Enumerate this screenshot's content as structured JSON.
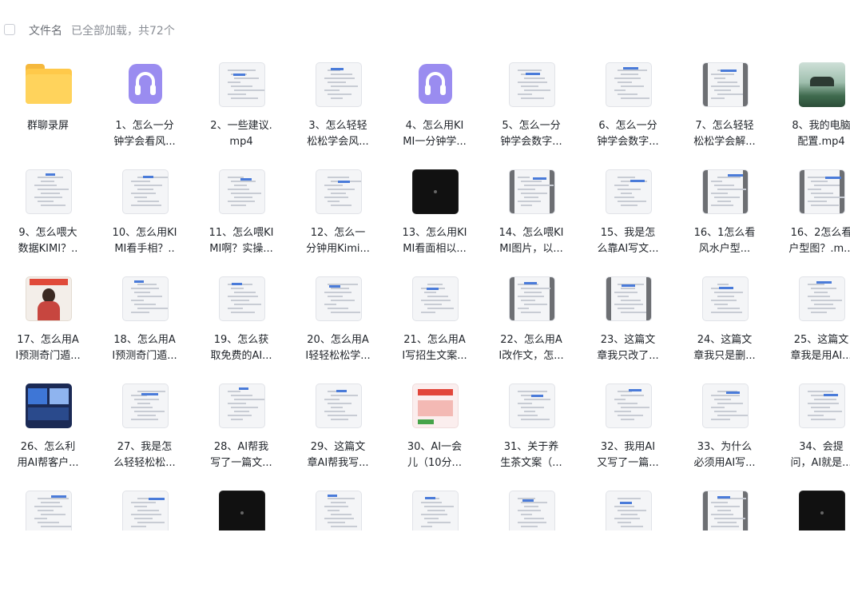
{
  "header": {
    "column_label": "文件名",
    "load_status": "已全部加载，共72个"
  },
  "rows": [
    [
      {
        "name": "群聊录屏",
        "thumb": "folder"
      },
      {
        "name": "1、怎么一分\n钟学会看风...",
        "thumb": "audio"
      },
      {
        "name": "2、一些建议.\nmp4",
        "thumb": "doc"
      },
      {
        "name": "3、怎么轻轻\n松松学会风...",
        "thumb": "doc"
      },
      {
        "name": "4、怎么用KI\nMI一分钟学...",
        "thumb": "audio"
      },
      {
        "name": "5、怎么一分\n钟学会数字...",
        "thumb": "doc"
      },
      {
        "name": "6、怎么一分\n钟学会数字...",
        "thumb": "doc"
      },
      {
        "name": "7、怎么轻轻\n松松学会解...",
        "thumb": "doc-dark"
      },
      {
        "name": "8、我的电脑\n配置.mp4",
        "thumb": "landscape"
      }
    ],
    [
      {
        "name": "9、怎么喂大\n数据KIMI？..",
        "thumb": "doc"
      },
      {
        "name": "10、怎么用KI\nMI看手相？..",
        "thumb": "doc"
      },
      {
        "name": "11、怎么喂KI\nMI啊？实操...",
        "thumb": "doc"
      },
      {
        "name": "12、怎么一\n分钟用Kimi...",
        "thumb": "doc"
      },
      {
        "name": "13、怎么用KI\nMI看面相以...",
        "thumb": "video-dark"
      },
      {
        "name": "14、怎么喂KI\nMI图片，以...",
        "thumb": "doc-dark"
      },
      {
        "name": "15、我是怎\n么靠AI写文...",
        "thumb": "doc"
      },
      {
        "name": "16、1怎么看\n风水户型...",
        "thumb": "doc-dark"
      },
      {
        "name": "16、2怎么看\n户型图？.m...",
        "thumb": "doc-dark"
      }
    ],
    [
      {
        "name": "17、怎么用A\nI预测奇门遁...",
        "thumb": "person"
      },
      {
        "name": "18、怎么用A\nI预测奇门遁...",
        "thumb": "doc"
      },
      {
        "name": "19、怎么获\n取免费的AI...",
        "thumb": "doc"
      },
      {
        "name": "20、怎么用A\nI轻轻松松学...",
        "thumb": "doc"
      },
      {
        "name": "21、怎么用A\nI写招生文案...",
        "thumb": "doc"
      },
      {
        "name": "22、怎么用A\nI改作文，怎...",
        "thumb": "doc-dark"
      },
      {
        "name": "23、这篇文\n章我只改了...",
        "thumb": "doc-dark"
      },
      {
        "name": "24、这篇文\n章我只是删...",
        "thumb": "doc"
      },
      {
        "name": "25、这篇文\n章我是用AI...",
        "thumb": "doc"
      }
    ],
    [
      {
        "name": "26、怎么利\n用AI帮客户...",
        "thumb": "news"
      },
      {
        "name": "27、我是怎\n么轻轻松松...",
        "thumb": "doc"
      },
      {
        "name": "28、AI帮我\n写了一篇文...",
        "thumb": "doc"
      },
      {
        "name": "29、这篇文\n章AI帮我写...",
        "thumb": "doc"
      },
      {
        "name": "30、AI一会\n儿（10分...",
        "thumb": "red"
      },
      {
        "name": "31、关于养\n生茶文案（...",
        "thumb": "doc"
      },
      {
        "name": "32、我用AI\n又写了一篇...",
        "thumb": "doc"
      },
      {
        "name": "33、为什么\n必须用AI写...",
        "thumb": "doc"
      },
      {
        "name": "34、会提\n问，AI就是...",
        "thumb": "doc"
      }
    ],
    [
      {
        "name": "",
        "thumb": "doc"
      },
      {
        "name": "",
        "thumb": "doc"
      },
      {
        "name": "",
        "thumb": "video-dark"
      },
      {
        "name": "",
        "thumb": "doc"
      },
      {
        "name": "",
        "thumb": "doc"
      },
      {
        "name": "",
        "thumb": "doc"
      },
      {
        "name": "",
        "thumb": "doc"
      },
      {
        "name": "",
        "thumb": "doc-dark"
      },
      {
        "name": "",
        "thumb": "video-dark"
      }
    ]
  ]
}
